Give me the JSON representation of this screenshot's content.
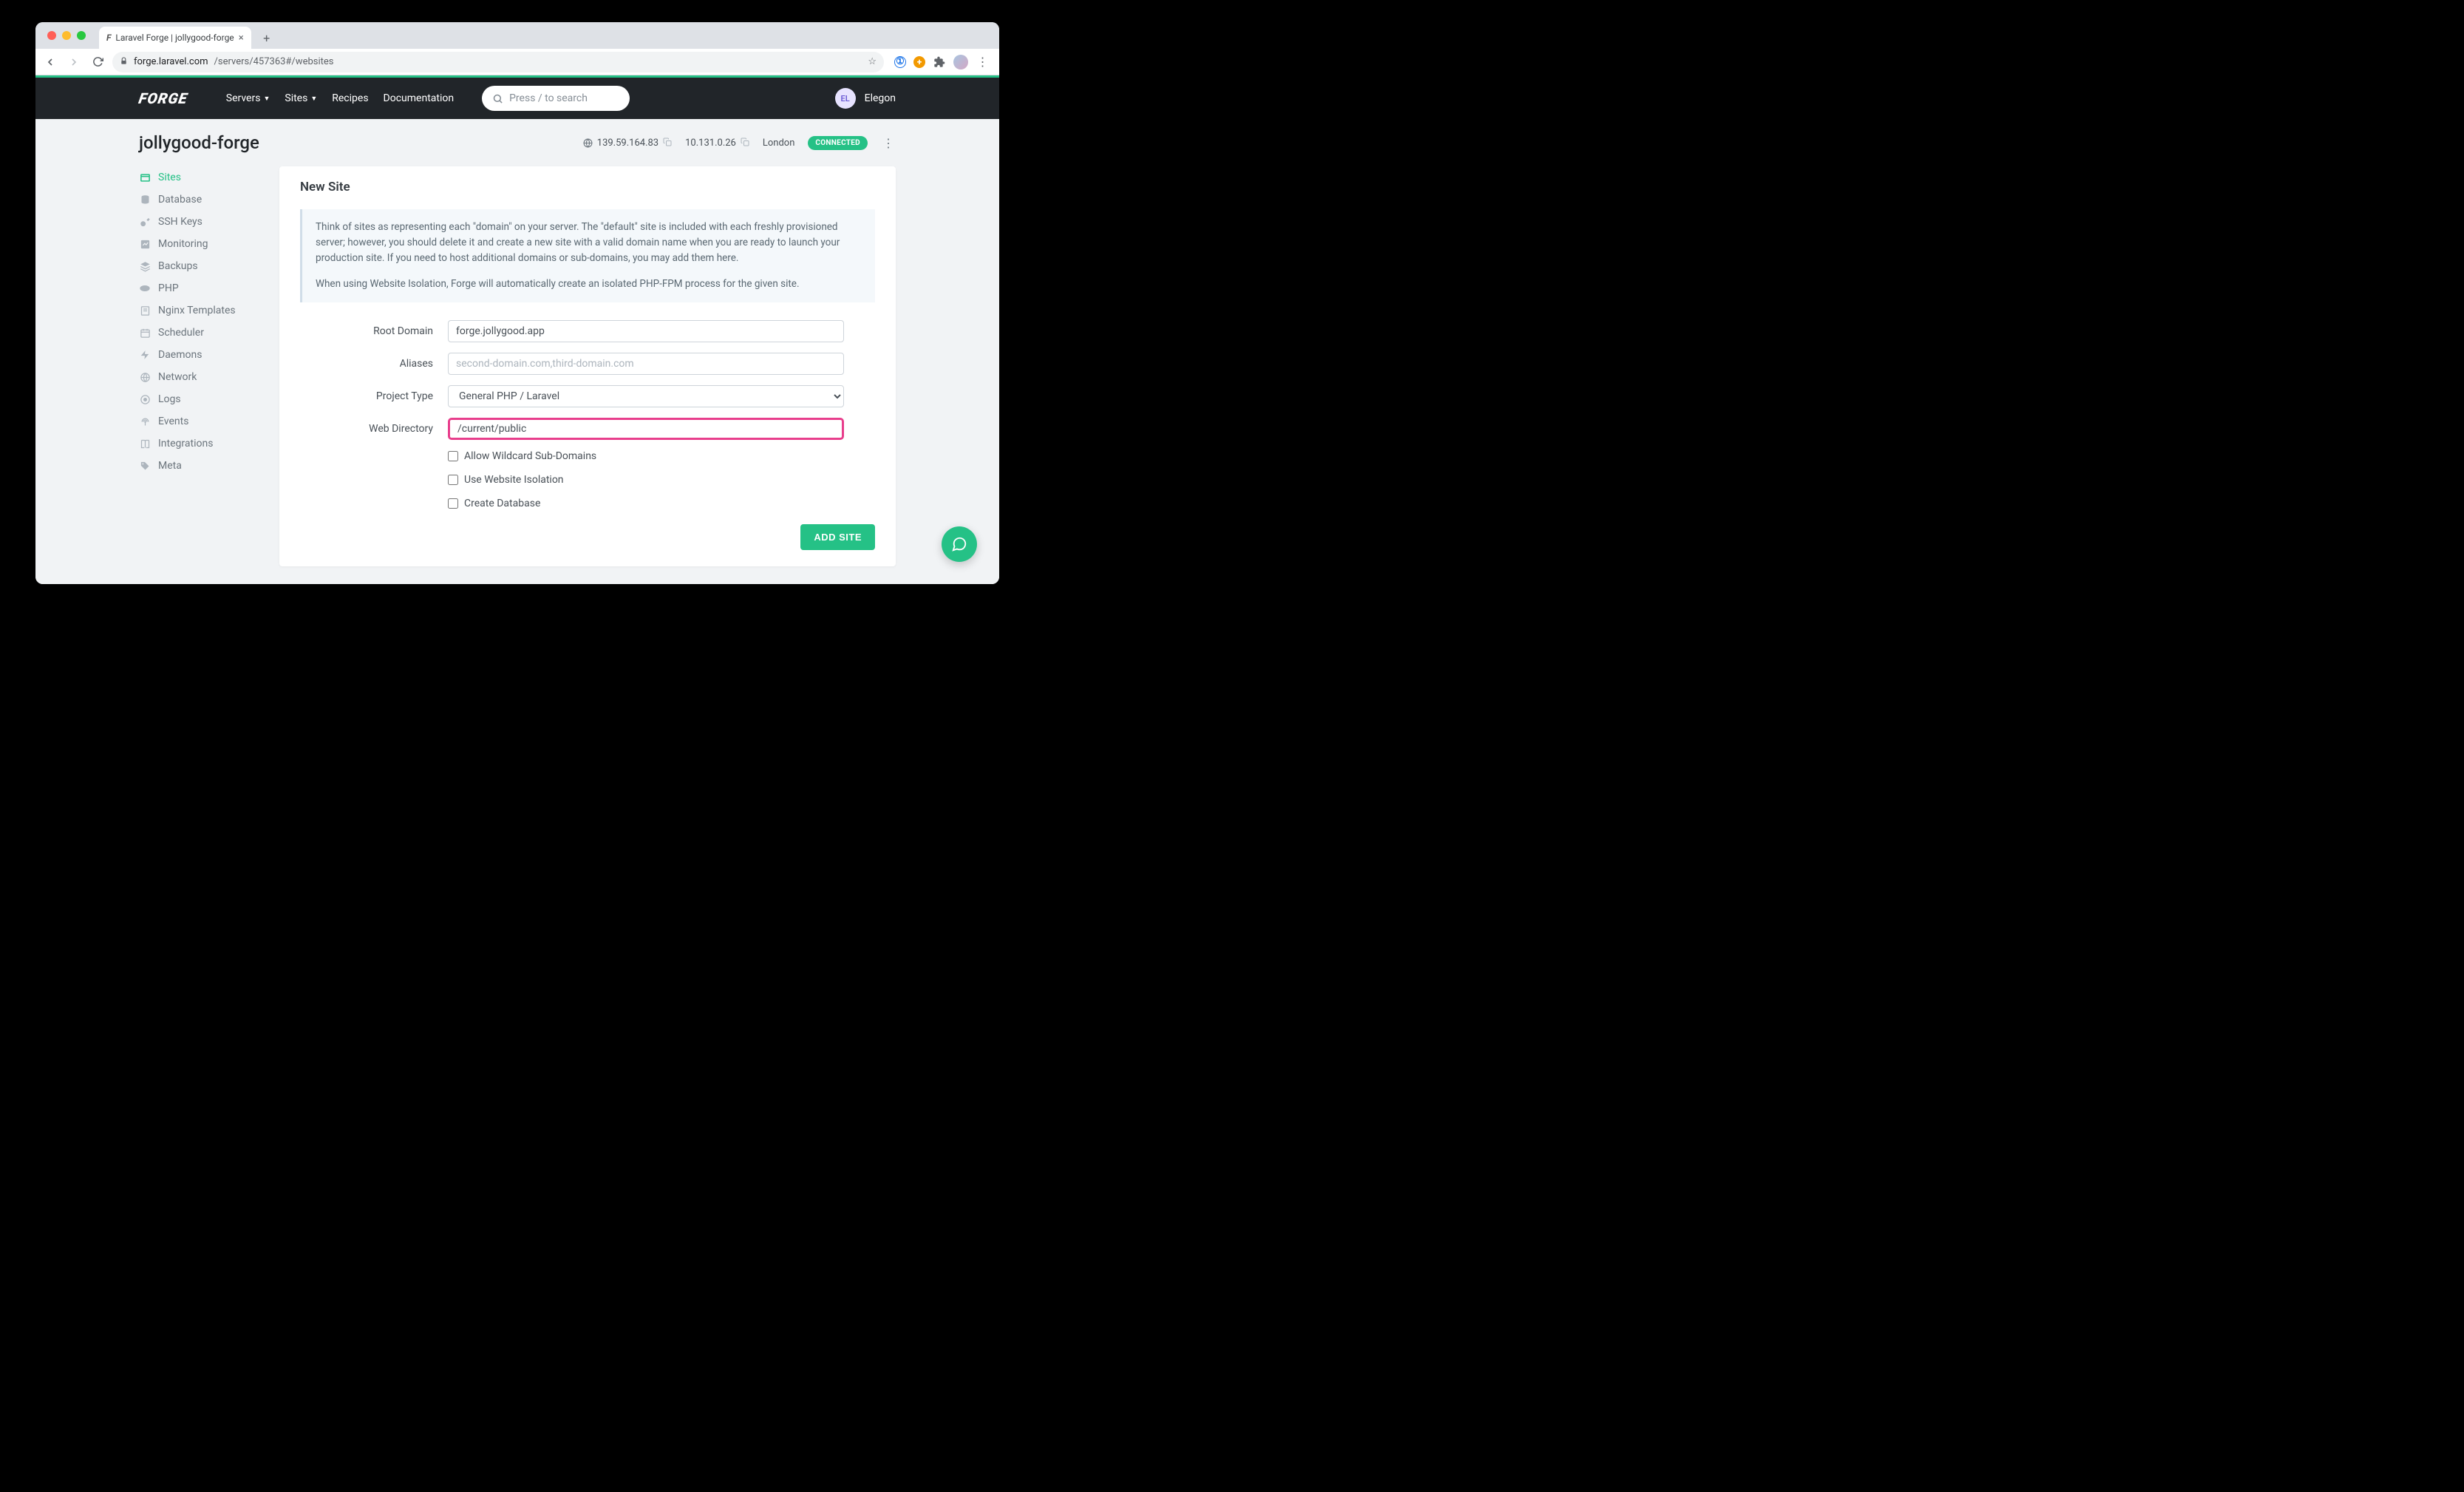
{
  "browser": {
    "tab_title": "Laravel Forge | jollygood-forge",
    "url_host": "forge.laravel.com",
    "url_path": "/servers/457363#/websites"
  },
  "nav": {
    "brand": "FORGE",
    "links": [
      "Servers",
      "Sites",
      "Recipes",
      "Documentation"
    ],
    "search_placeholder": "Press / to search",
    "user_initials": "EL",
    "user_name": "Elegon"
  },
  "header": {
    "server_name": "jollygood-forge",
    "public_ip": "139.59.164.83",
    "private_ip": "10.131.0.26",
    "location": "London",
    "status": "CONNECTED"
  },
  "sidebar": {
    "items": [
      {
        "label": "Sites",
        "icon": "window"
      },
      {
        "label": "Database",
        "icon": "database"
      },
      {
        "label": "SSH Keys",
        "icon": "key"
      },
      {
        "label": "Monitoring",
        "icon": "chart"
      },
      {
        "label": "Backups",
        "icon": "layers"
      },
      {
        "label": "PHP",
        "icon": "php"
      },
      {
        "label": "Nginx Templates",
        "icon": "template"
      },
      {
        "label": "Scheduler",
        "icon": "calendar"
      },
      {
        "label": "Daemons",
        "icon": "bolt"
      },
      {
        "label": "Network",
        "icon": "globe"
      },
      {
        "label": "Logs",
        "icon": "logs"
      },
      {
        "label": "Events",
        "icon": "broadcast"
      },
      {
        "label": "Integrations",
        "icon": "book"
      },
      {
        "label": "Meta",
        "icon": "tag"
      }
    ]
  },
  "card": {
    "title": "New Site",
    "info_p1": "Think of sites as representing each \"domain\" on your server. The \"default\" site is included with each freshly provisioned server; however, you should delete it and create a new site with a valid domain name when you are ready to launch your production site. If you need to host additional domains or sub-domains, you may add them here.",
    "info_p2": "When using Website Isolation, Forge will automatically create an isolated PHP-FPM process for the given site.",
    "labels": {
      "root_domain": "Root Domain",
      "aliases": "Aliases",
      "project_type": "Project Type",
      "web_directory": "Web Directory"
    },
    "values": {
      "root_domain": "forge.jollygood.app",
      "aliases_placeholder": "second-domain.com,third-domain.com",
      "project_type": "General PHP / Laravel",
      "web_directory": "/current/public"
    },
    "checkboxes": {
      "wildcard": "Allow Wildcard Sub-Domains",
      "isolation": "Use Website Isolation",
      "database": "Create Database"
    },
    "submit": "ADD SITE"
  }
}
